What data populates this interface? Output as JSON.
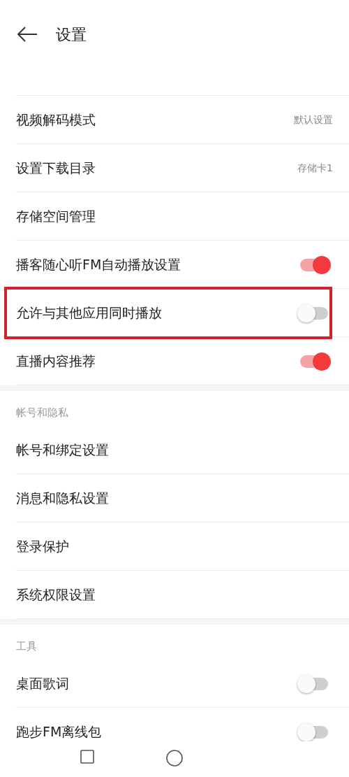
{
  "header": {
    "title": "设置"
  },
  "sections": [
    {
      "rows": [
        {
          "kind": "value",
          "label": "视频解码模式",
          "value": "默认设置",
          "highlighted": false
        },
        {
          "kind": "value",
          "label": "设置下载目录",
          "value": "存储卡1",
          "highlighted": false
        },
        {
          "kind": "link",
          "label": "存储空间管理",
          "highlighted": false
        },
        {
          "kind": "toggle",
          "label": "播客随心听FM自动播放设置",
          "on": true,
          "highlighted": false
        },
        {
          "kind": "toggle",
          "label": "允许与其他应用同时播放",
          "on": false,
          "highlighted": true
        },
        {
          "kind": "toggle",
          "label": "直播内容推荐",
          "on": true,
          "highlighted": false
        }
      ]
    },
    {
      "title": "帐号和隐私",
      "rows": [
        {
          "kind": "link",
          "label": "帐号和绑定设置",
          "highlighted": false
        },
        {
          "kind": "link",
          "label": "消息和隐私设置",
          "highlighted": false
        },
        {
          "kind": "link",
          "label": "登录保护",
          "highlighted": false
        },
        {
          "kind": "link",
          "label": "系统权限设置",
          "highlighted": false
        }
      ]
    },
    {
      "title": "工具",
      "rows": [
        {
          "kind": "toggle",
          "label": "桌面歌词",
          "on": false,
          "highlighted": false
        },
        {
          "kind": "toggle",
          "label": "跑步FM离线包",
          "on": false,
          "highlighted": false
        }
      ]
    }
  ]
}
